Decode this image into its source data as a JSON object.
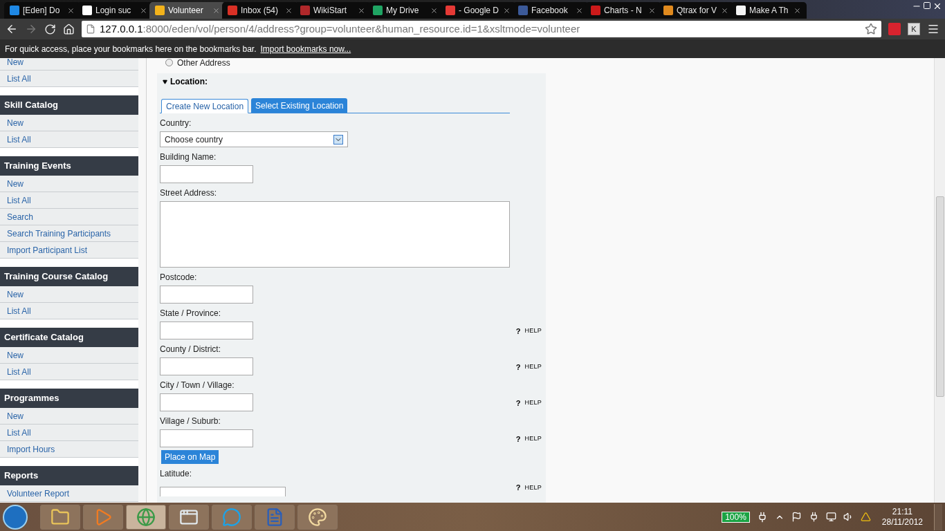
{
  "browser": {
    "tabs": [
      {
        "title": "[Eden] Do",
        "selected": false,
        "color": "#1e88e5"
      },
      {
        "title": "Login suc",
        "selected": false,
        "color": "#ffffff"
      },
      {
        "title": "Volunteer",
        "selected": true,
        "color": "#f2b21b"
      },
      {
        "title": "Inbox (54)",
        "selected": false,
        "color": "#d93025"
      },
      {
        "title": "WikiStart",
        "selected": false,
        "color": "#b0282a"
      },
      {
        "title": "My Drive",
        "selected": false,
        "color": "#1fa463"
      },
      {
        "title": "- Google D",
        "selected": false,
        "color": "#e53935"
      },
      {
        "title": "Facebook",
        "selected": false,
        "color": "#3b5998"
      },
      {
        "title": "Charts - N",
        "selected": false,
        "color": "#cc1a1a"
      },
      {
        "title": "Qtrax for V",
        "selected": false,
        "color": "#e08a1e"
      },
      {
        "title": "Make A Th",
        "selected": false,
        "color": "#f5f5f5"
      }
    ],
    "url_host": "127.0.0.1",
    "url_rest": ":8000/eden/vol/person/4/address?group=volunteer&human_resource.id=1&xsltmode=volunteer",
    "extension_label": "K",
    "bookmarks_text": "For quick access, place your bookmarks here on the bookmarks bar.",
    "bookmarks_link": "Import bookmarks now..."
  },
  "sidebar": [
    {
      "items": [
        "New",
        "List All"
      ]
    },
    {
      "heading": "Skill Catalog",
      "items": [
        "New",
        "List All"
      ]
    },
    {
      "heading": "Training Events",
      "items": [
        "New",
        "List All",
        "Search",
        "Search Training Participants",
        "Import Participant List"
      ]
    },
    {
      "heading": "Training Course Catalog",
      "items": [
        "New",
        "List All"
      ]
    },
    {
      "heading": "Certificate Catalog",
      "items": [
        "New",
        "List All"
      ]
    },
    {
      "heading": "Programmes",
      "items": [
        "New",
        "List All",
        "Import Hours"
      ]
    },
    {
      "heading": "Reports",
      "items": [
        "Volunteer Report"
      ]
    }
  ],
  "form": {
    "radio": {
      "label": "Other Address",
      "checked": false
    },
    "section": {
      "title": "Location:",
      "expanded": true
    },
    "tabs": [
      {
        "label": "Create New Location",
        "selected": true
      },
      {
        "label": "Select Existing Location",
        "selected": false
      }
    ],
    "fields": [
      {
        "kind": "select",
        "label": "Country:",
        "value": "Choose country"
      },
      {
        "kind": "text",
        "label": "Building Name:"
      },
      {
        "kind": "textarea",
        "label": "Street Address:"
      },
      {
        "kind": "text",
        "label": "Postcode:"
      },
      {
        "kind": "text",
        "label": "State / Province:",
        "help": {
          "mark": "?",
          "label": "HELP"
        }
      },
      {
        "kind": "text",
        "label": "County / District:",
        "help": {
          "mark": "?",
          "label": "HELP"
        }
      },
      {
        "kind": "text",
        "label": "City / Town / Village:",
        "help": {
          "mark": "?",
          "label": "HELP"
        }
      },
      {
        "kind": "text",
        "label": "Village / Suburb:",
        "help": {
          "mark": "?",
          "label": "HELP"
        }
      },
      {
        "kind": "button",
        "label": "Place on Map"
      },
      {
        "kind": "wide",
        "label": "Latitude:",
        "help": {
          "mark": "?",
          "label": "HELP"
        }
      }
    ]
  },
  "taskbar": {
    "apps": [
      {
        "kind": "folder"
      },
      {
        "kind": "media"
      },
      {
        "kind": "browser",
        "selected": true
      },
      {
        "kind": "window"
      },
      {
        "kind": "chat"
      },
      {
        "kind": "document"
      },
      {
        "kind": "paint"
      }
    ],
    "battery": "100%",
    "time": "21:11",
    "date": "28/11/2012"
  }
}
